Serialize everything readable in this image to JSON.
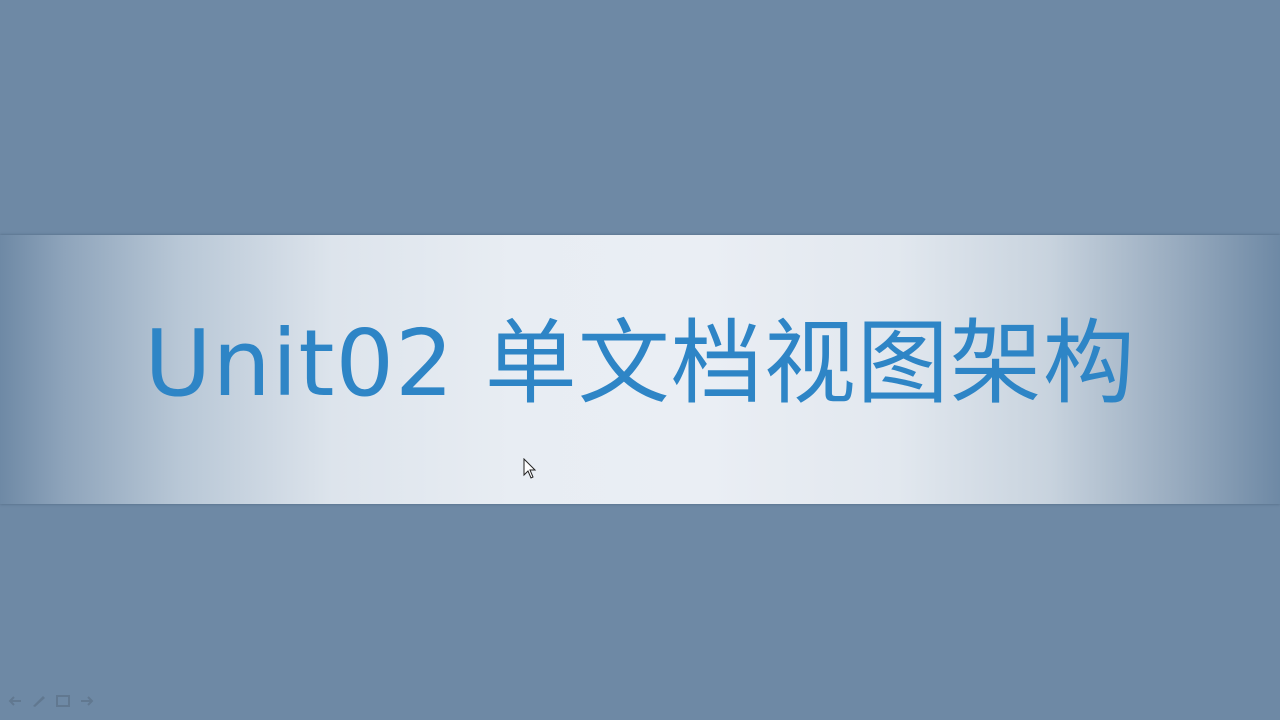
{
  "slide": {
    "title": "Unit02 单文档视图架构"
  },
  "colors": {
    "background": "#6e89a5",
    "banner_center": "#eaeef4",
    "title_text": "#2e85c6"
  },
  "toolbar": {
    "icons": [
      "prev-arrow-icon",
      "pen-icon",
      "slide-menu-icon",
      "next-arrow-icon"
    ]
  }
}
